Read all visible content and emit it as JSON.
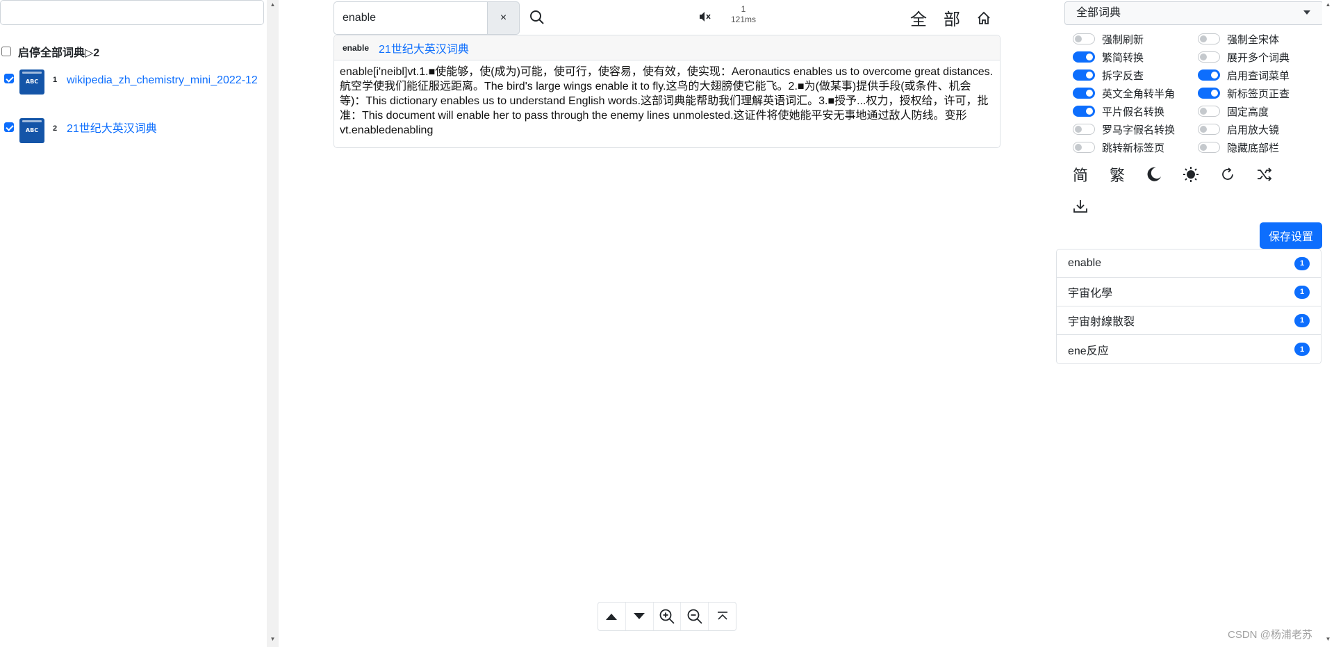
{
  "left": {
    "search_placeholder": "",
    "toggle_all_label": "启停全部词典▷2",
    "dicts": [
      {
        "index": "1",
        "name": "wikipedia_zh_chemistry_mini_2022-12",
        "checked": true,
        "icon_text": "ABC"
      },
      {
        "index": "2",
        "name": "21世纪大英汉词典",
        "checked": true,
        "icon_text": "ABC"
      }
    ]
  },
  "search": {
    "value": "enable",
    "clear_label": "×",
    "count": "1",
    "time": "121ms"
  },
  "header_actions": {
    "all_label": "全",
    "part_label": "部"
  },
  "result": {
    "word": "enable",
    "dict": "21世纪大英汉词典",
    "body": "enable[i'neibl]vt.1.■使能够，使(成为)可能，使可行，使容易，使有效，使实现：Aeronautics enables us to overcome great distances.航空学使我们能征服远距离。The bird's large wings enable it to fly.这鸟的大翅膀使它能飞。2.■为(做某事)提供手段(或条件、机会等)：This dictionary enables us to understand English words.这部词典能帮助我们理解英语词汇。3.■授予...权力，授权给，许可，批准：This document will enable her to pass through the enemy lines unmolested.这证件将使她能平安无事地通过敌人防线。变形vt.enabledenabling"
  },
  "right": {
    "scope_selected": "全部词典",
    "settings_left": [
      {
        "label": "强制刷新",
        "on": false
      },
      {
        "label": "繁简转换",
        "on": true
      },
      {
        "label": "拆字反查",
        "on": true
      },
      {
        "label": "英文全角转半角",
        "on": true
      },
      {
        "label": "平片假名转换",
        "on": true
      },
      {
        "label": "罗马字假名转换",
        "on": false
      },
      {
        "label": "跳转新标签页",
        "on": false
      }
    ],
    "settings_right": [
      {
        "label": "强制全宋体",
        "on": false
      },
      {
        "label": "展开多个词典",
        "on": false
      },
      {
        "label": "启用查词菜单",
        "on": true
      },
      {
        "label": "新标签页正查",
        "on": true
      },
      {
        "label": "固定高度",
        "on": false
      },
      {
        "label": "启用放大镜",
        "on": false
      },
      {
        "label": "隐藏底部栏",
        "on": false
      }
    ],
    "tools": {
      "simplified": "简",
      "traditional": "繁"
    },
    "save_label": "保存设置",
    "words": [
      {
        "word": "enable",
        "count": "1"
      },
      {
        "word": "宇宙化學",
        "count": "1"
      },
      {
        "word": "宇宙射線散裂",
        "count": "1"
      },
      {
        "word": "ene反应",
        "count": "1"
      }
    ]
  },
  "watermark": "CSDN @杨浦老苏"
}
